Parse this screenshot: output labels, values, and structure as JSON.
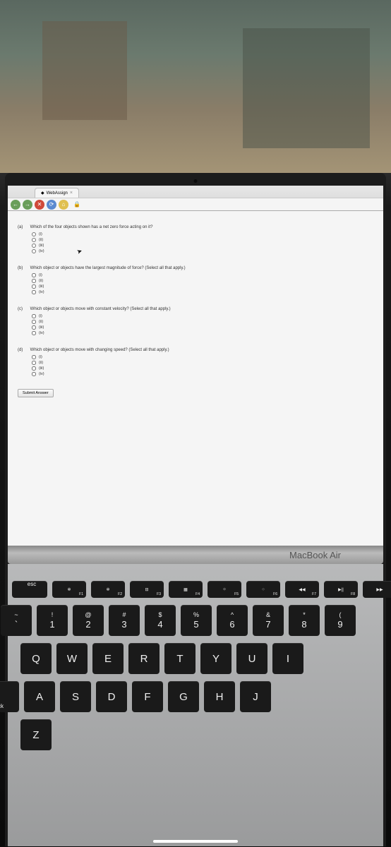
{
  "tab": {
    "title": "WebAssign"
  },
  "questions": {
    "a": {
      "label": "(a)",
      "text": "Which of the four objects shown has a net zero force acting on it?",
      "type": "radio",
      "options": [
        "(i)",
        "(ii)",
        "(iii)",
        "(iv)"
      ]
    },
    "b": {
      "label": "(b)",
      "text": "Which object or objects have the largest magnitude of force? (Select all that apply.)",
      "type": "checkbox",
      "options": [
        "(i)",
        "(ii)",
        "(iii)",
        "(iv)"
      ]
    },
    "c": {
      "label": "(c)",
      "text": "Which object or objects move with constant velocity? (Select all that apply.)",
      "type": "checkbox",
      "options": [
        "(i)",
        "(ii)",
        "(iii)",
        "(iv)"
      ]
    },
    "d": {
      "label": "(d)",
      "text": "Which object or objects move with changing speed? (Select all that apply.)",
      "type": "checkbox",
      "options": [
        "(i)",
        "(ii)",
        "(iii)",
        "(iv)"
      ]
    }
  },
  "submit_label": "Submit Answer",
  "macbook_label": "MacBook Air",
  "keys": {
    "esc": "esc",
    "fn": [
      "F1",
      "F2",
      "F3",
      "F4",
      "F5",
      "F6",
      "F7",
      "F8"
    ],
    "fn_icons": [
      "✲",
      "✲",
      "⊟",
      "▦",
      "☼",
      "⁘",
      "◀◀",
      "▶||",
      "▶▶"
    ],
    "num_top": [
      "!",
      "@",
      "#",
      "$",
      "%",
      "^",
      "&",
      "*",
      "("
    ],
    "num_main": [
      "1",
      "2",
      "3",
      "4",
      "5",
      "6",
      "7",
      "8",
      "9"
    ],
    "tilde_top": "~",
    "tilde_main": "`",
    "row_q": [
      "Q",
      "W",
      "E",
      "R",
      "T",
      "Y",
      "U",
      "I"
    ],
    "row_a": [
      "A",
      "S",
      "D",
      "F",
      "G",
      "H",
      "J"
    ],
    "row_z_start": "Z",
    "caps": "ck"
  }
}
